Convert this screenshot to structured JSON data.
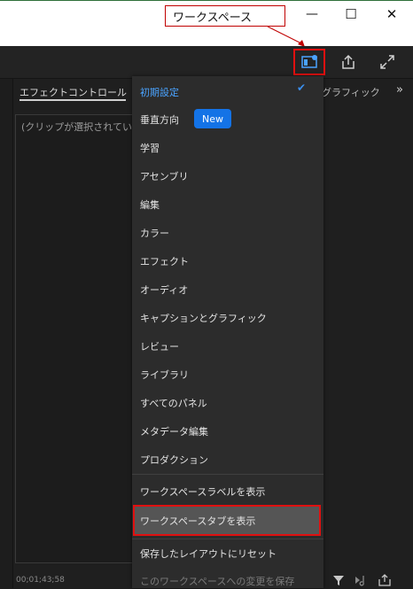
{
  "callout": {
    "label": "ワークスペース"
  },
  "window": {
    "minimize": "—",
    "maximize": "☐",
    "close": "✕"
  },
  "panel": {
    "title": "エフェクトコントロール",
    "empty_message": "(クリップが選択されていませ",
    "timecode": "00;01;43;58",
    "graphics_tab": "グラフィック",
    "more": "»"
  },
  "menu": {
    "selected": "初期設定",
    "items": [
      "垂直方向",
      "学習",
      "アセンブリ",
      "編集",
      "カラー",
      "エフェクト",
      "オーディオ",
      "キャプションとグラフィック",
      "レビュー",
      "ライブラリ",
      "すべてのパネル",
      "メタデータ編集",
      "プロダクション"
    ],
    "new_badge": "New",
    "show_labels": "ワークスペースラベルを表示",
    "show_tabs": "ワークスペースタブを表示",
    "reset": "保存したレイアウトにリセット",
    "save_changes": "このワークスペースへの変更を保存"
  },
  "colors": {
    "accent": "#1473e6",
    "highlight": "#e01010",
    "check": "#3a8ff0"
  },
  "icons": {
    "workspace": "workspace-icon",
    "share": "share-icon",
    "fullscreen": "fullscreen-icon",
    "filter": "filter-icon",
    "audio": "audio-icon",
    "export": "export-icon"
  }
}
